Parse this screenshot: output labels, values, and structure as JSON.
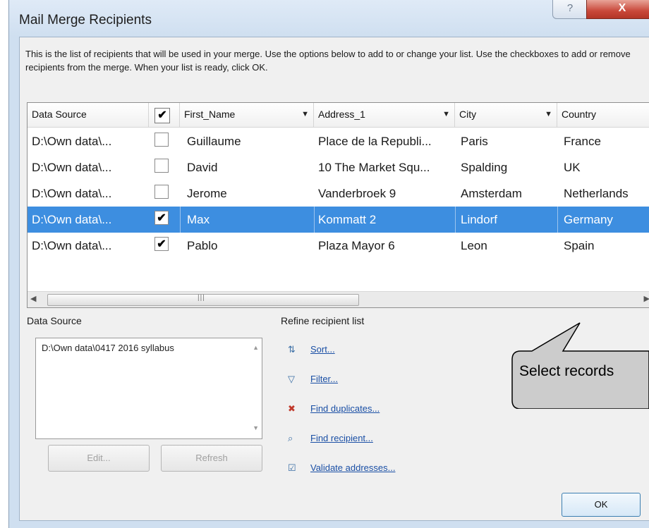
{
  "window": {
    "title": "Mail Merge Recipients",
    "help_glyph": "?",
    "close_glyph": "X"
  },
  "intro": "This is the list of recipients that will be used in your merge. Use the options below to add to or change your list. Use the checkboxes to add or remove recipients from the merge. When your list is ready, click OK.",
  "grid": {
    "columns": [
      "Data Source",
      "First_Name",
      "Address_1",
      "City",
      "Country"
    ],
    "header_checked": "✔",
    "rows": [
      {
        "source": "D:\\Own data\\...",
        "checked": "",
        "first": "Guillaume",
        "address": "Place de la Republi...",
        "city": "Paris",
        "country": "France",
        "selected": false
      },
      {
        "source": "D:\\Own data\\...",
        "checked": "",
        "first": "David",
        "address": "10 The Market Squ...",
        "city": "Spalding",
        "country": "UK",
        "selected": false
      },
      {
        "source": "D:\\Own data\\...",
        "checked": "",
        "first": "Jerome",
        "address": "Vanderbroek 9",
        "city": "Amsterdam",
        "country": "Netherlands",
        "selected": false
      },
      {
        "source": "D:\\Own data\\...",
        "checked": "✔",
        "first": "Max",
        "address": "Kommatt 2",
        "city": "Lindorf",
        "country": "Germany",
        "selected": true
      },
      {
        "source": "D:\\Own data\\...",
        "checked": "✔",
        "first": "Pablo",
        "address": "Plaza Mayor 6",
        "city": "Leon",
        "country": "Spain",
        "selected": false
      }
    ],
    "scroll_grip": "|||"
  },
  "data_source": {
    "label": "Data Source",
    "item": "D:\\Own data\\0417 2016 syllabus",
    "edit_label": "Edit...",
    "refresh_label": "Refresh"
  },
  "refine": {
    "label": "Refine recipient list",
    "links": [
      {
        "label": "Sort...",
        "icon": "sort-icon"
      },
      {
        "label": "Filter...",
        "icon": "filter-icon"
      },
      {
        "label": "Find duplicates...",
        "icon": "find-duplicates-icon"
      },
      {
        "label": "Find recipient...",
        "icon": "find-recipient-icon"
      },
      {
        "label": "Validate addresses...",
        "icon": "validate-icon"
      }
    ]
  },
  "ok_label": "OK",
  "callout": "Select records"
}
